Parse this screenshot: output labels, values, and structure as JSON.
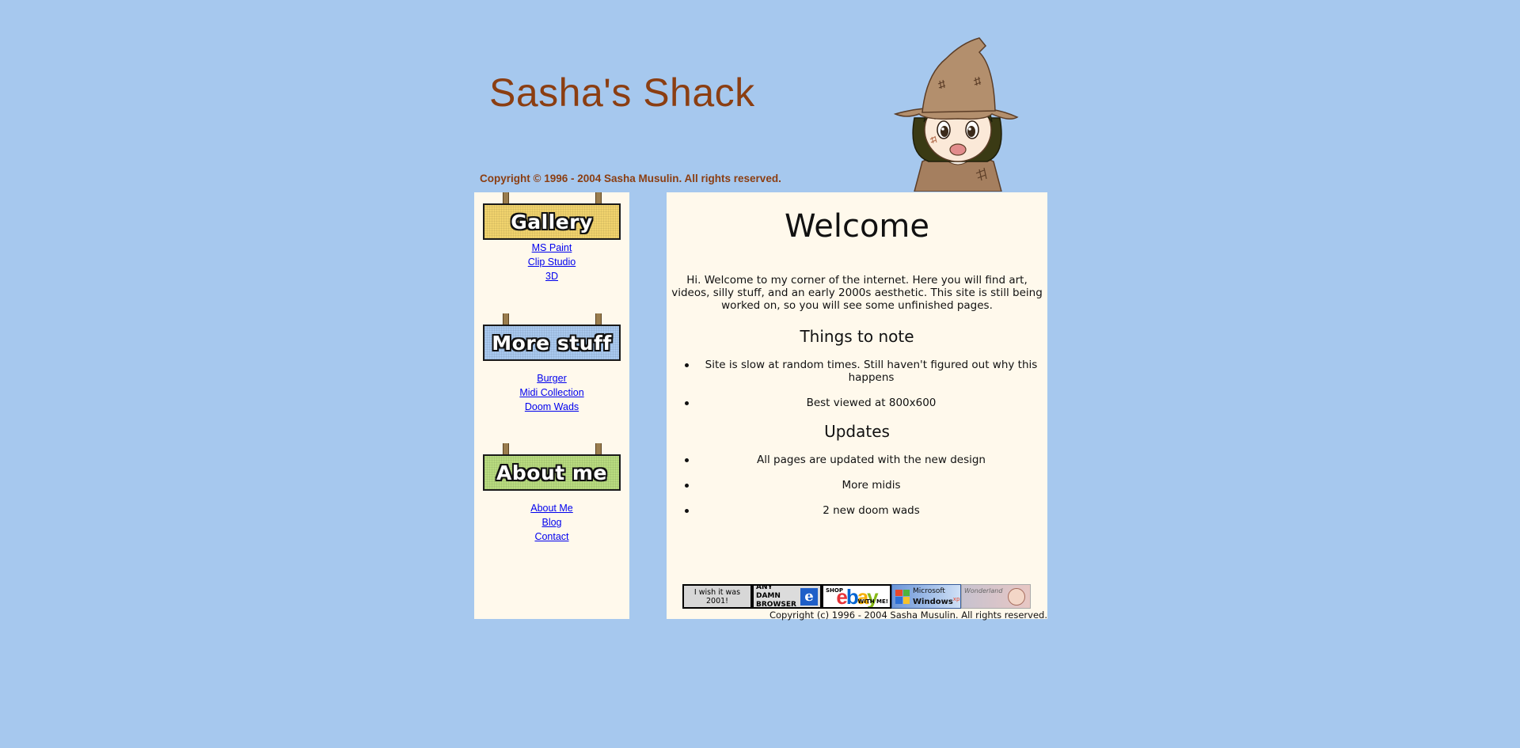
{
  "header": {
    "title": "Sasha's Shack",
    "copyright": "Copyright © 1996 - 2004 Sasha Musulin. All rights reserved."
  },
  "colors": {
    "page_background": "#a6c8ee",
    "panel_background": "#fff9ec",
    "title_color": "#8b3e12",
    "link_color": "#0000ee",
    "gallery_sign": "#f1d36d",
    "more_stuff_sign": "#a9c9ef",
    "about_sign": "#b9dc7f"
  },
  "sidebar": {
    "sections": [
      {
        "heading": "Gallery",
        "links": [
          "MS Paint",
          "Clip Studio",
          "3D"
        ]
      },
      {
        "heading": "More stuff",
        "links": [
          "Burger",
          "Midi Collection",
          "Doom Wads"
        ]
      },
      {
        "heading": "About me",
        "links": [
          "About Me",
          "Blog",
          "Contact"
        ]
      }
    ]
  },
  "main": {
    "heading": "Welcome",
    "intro": "Hi. Welcome to my corner of the internet. Here you will find art, videos, silly stuff, and an early 2000s aesthetic. This site is still being worked on, so you will see some unfinished pages.",
    "notes_heading": "Things to note",
    "notes": [
      "Site is slow at random times. Still haven't figured out why this happens",
      "Best viewed at 800x600"
    ],
    "updates_heading": "Updates",
    "updates": [
      "All pages are updated with the new design",
      "More midis",
      "2 new doom wads"
    ],
    "badges": {
      "wish": "I wish it was 2001!",
      "browser": "ANY DAMN BROWSER",
      "browser_icon": "e",
      "ebay_top": "SHOP",
      "ebay_logo": "ebay",
      "ebay_bottom": "WITH ME!",
      "windows_brand": "Microsoft",
      "windows_name": "Windows",
      "windows_suffix": "xp",
      "wonderland": "Wonderland"
    },
    "footer": "Copyright (c) 1996 - 2004 Sasha Musulin. All rights reserved."
  },
  "icons": {
    "mascot": "scarecrow-girl-mascot-image",
    "browser": "internet-explorer-icon",
    "windows": "windows-flag-icon"
  }
}
